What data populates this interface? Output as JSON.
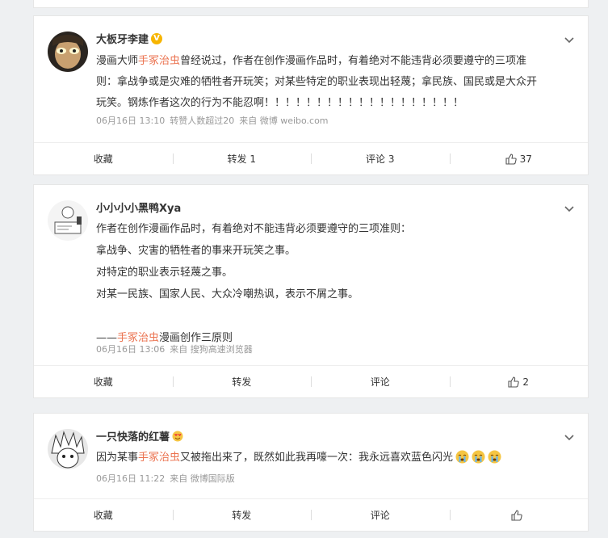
{
  "posts": [
    {
      "author": "大板牙李建",
      "verified_badge": "V",
      "text_lines": [
        {
          "pre": "漫画大师",
          "name": "手冢治虫",
          "post": "曾经说过，作者在创作漫画作品时，有着绝对不能违背必须要遵守的三项准"
        },
        {
          "pre": "则：拿战争或是灾难的牺牲者开玩笑；对某些特定的职业表现出轻蔑；拿民族、国民或是大众开",
          "name": "",
          "post": ""
        },
        {
          "pre": "玩笑。钢炼作者这次的行为不能忍啊！！！！！！！！！！！！！！！！！！！",
          "name": "",
          "post": ""
        }
      ],
      "meta": {
        "date": "06月16日 13:10",
        "extra": "转赞人数超过20",
        "source": "来自 微博 weibo.com"
      },
      "actions": {
        "favorite": "收藏",
        "repost": "转发 1",
        "comment": "评论 3",
        "like": "37"
      }
    },
    {
      "author": "小小小小黑鸭Xya",
      "text_lines": [
        "作者在创作漫画作品时，有着绝对不能违背必须要遵守的三项准则：",
        "拿战争、灾害的牺牲者的事来开玩笑之事。",
        "对特定的职业表示轻蔑之事。",
        "对某一民族、国家人民、大众冷嘲热讽，表示不屑之事。"
      ],
      "signature": {
        "dash": "——",
        "name": "手冢治虫",
        "rest": "漫画创作三原则"
      },
      "meta": {
        "date": "06月16日 13:06",
        "source": "来自 搜狗高速浏览器"
      },
      "actions": {
        "favorite": "收藏",
        "repost": "转发",
        "comment": "评论",
        "like": "2"
      }
    },
    {
      "author": "一只快落的红薯",
      "text": {
        "pre": "因为某事",
        "name": "手冢治虫",
        "post": "又被拖出来了，既然如此我再嚎一次：我永远喜欢蓝色闪光"
      },
      "meta": {
        "date": "06月16日 11:22",
        "source": "来自 微博国际版"
      },
      "actions": {
        "favorite": "收藏",
        "repost": "转发",
        "comment": "评论",
        "like": ""
      }
    }
  ],
  "colors": {
    "accent_name": "#eb7350",
    "verified": "#f7b500",
    "meta": "#999999",
    "background": "#eef0f2"
  },
  "icons": [
    "chevron-down-icon",
    "thumbs-up-icon",
    "crying-emoji-icon",
    "heart-eyes-emoji-icon",
    "verified-badge-icon"
  ]
}
